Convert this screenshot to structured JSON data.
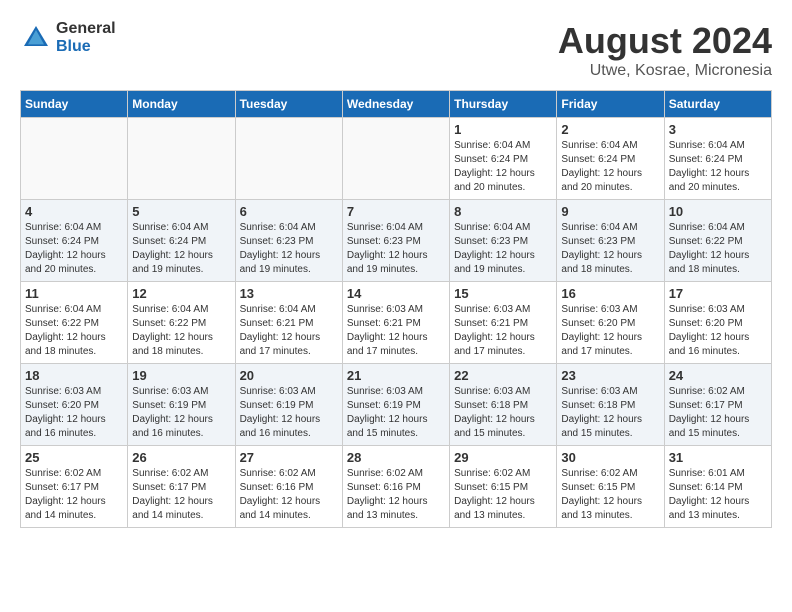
{
  "header": {
    "logo_general": "General",
    "logo_blue": "Blue",
    "month_year": "August 2024",
    "location": "Utwe, Kosrae, Micronesia"
  },
  "days_of_week": [
    "Sunday",
    "Monday",
    "Tuesday",
    "Wednesday",
    "Thursday",
    "Friday",
    "Saturday"
  ],
  "weeks": [
    [
      {
        "day": "",
        "info": ""
      },
      {
        "day": "",
        "info": ""
      },
      {
        "day": "",
        "info": ""
      },
      {
        "day": "",
        "info": ""
      },
      {
        "day": "1",
        "info": "Sunrise: 6:04 AM\nSunset: 6:24 PM\nDaylight: 12 hours\nand 20 minutes."
      },
      {
        "day": "2",
        "info": "Sunrise: 6:04 AM\nSunset: 6:24 PM\nDaylight: 12 hours\nand 20 minutes."
      },
      {
        "day": "3",
        "info": "Sunrise: 6:04 AM\nSunset: 6:24 PM\nDaylight: 12 hours\nand 20 minutes."
      }
    ],
    [
      {
        "day": "4",
        "info": "Sunrise: 6:04 AM\nSunset: 6:24 PM\nDaylight: 12 hours\nand 20 minutes."
      },
      {
        "day": "5",
        "info": "Sunrise: 6:04 AM\nSunset: 6:24 PM\nDaylight: 12 hours\nand 19 minutes."
      },
      {
        "day": "6",
        "info": "Sunrise: 6:04 AM\nSunset: 6:23 PM\nDaylight: 12 hours\nand 19 minutes."
      },
      {
        "day": "7",
        "info": "Sunrise: 6:04 AM\nSunset: 6:23 PM\nDaylight: 12 hours\nand 19 minutes."
      },
      {
        "day": "8",
        "info": "Sunrise: 6:04 AM\nSunset: 6:23 PM\nDaylight: 12 hours\nand 19 minutes."
      },
      {
        "day": "9",
        "info": "Sunrise: 6:04 AM\nSunset: 6:23 PM\nDaylight: 12 hours\nand 18 minutes."
      },
      {
        "day": "10",
        "info": "Sunrise: 6:04 AM\nSunset: 6:22 PM\nDaylight: 12 hours\nand 18 minutes."
      }
    ],
    [
      {
        "day": "11",
        "info": "Sunrise: 6:04 AM\nSunset: 6:22 PM\nDaylight: 12 hours\nand 18 minutes."
      },
      {
        "day": "12",
        "info": "Sunrise: 6:04 AM\nSunset: 6:22 PM\nDaylight: 12 hours\nand 18 minutes."
      },
      {
        "day": "13",
        "info": "Sunrise: 6:04 AM\nSunset: 6:21 PM\nDaylight: 12 hours\nand 17 minutes."
      },
      {
        "day": "14",
        "info": "Sunrise: 6:03 AM\nSunset: 6:21 PM\nDaylight: 12 hours\nand 17 minutes."
      },
      {
        "day": "15",
        "info": "Sunrise: 6:03 AM\nSunset: 6:21 PM\nDaylight: 12 hours\nand 17 minutes."
      },
      {
        "day": "16",
        "info": "Sunrise: 6:03 AM\nSunset: 6:20 PM\nDaylight: 12 hours\nand 17 minutes."
      },
      {
        "day": "17",
        "info": "Sunrise: 6:03 AM\nSunset: 6:20 PM\nDaylight: 12 hours\nand 16 minutes."
      }
    ],
    [
      {
        "day": "18",
        "info": "Sunrise: 6:03 AM\nSunset: 6:20 PM\nDaylight: 12 hours\nand 16 minutes."
      },
      {
        "day": "19",
        "info": "Sunrise: 6:03 AM\nSunset: 6:19 PM\nDaylight: 12 hours\nand 16 minutes."
      },
      {
        "day": "20",
        "info": "Sunrise: 6:03 AM\nSunset: 6:19 PM\nDaylight: 12 hours\nand 16 minutes."
      },
      {
        "day": "21",
        "info": "Sunrise: 6:03 AM\nSunset: 6:19 PM\nDaylight: 12 hours\nand 15 minutes."
      },
      {
        "day": "22",
        "info": "Sunrise: 6:03 AM\nSunset: 6:18 PM\nDaylight: 12 hours\nand 15 minutes."
      },
      {
        "day": "23",
        "info": "Sunrise: 6:03 AM\nSunset: 6:18 PM\nDaylight: 12 hours\nand 15 minutes."
      },
      {
        "day": "24",
        "info": "Sunrise: 6:02 AM\nSunset: 6:17 PM\nDaylight: 12 hours\nand 15 minutes."
      }
    ],
    [
      {
        "day": "25",
        "info": "Sunrise: 6:02 AM\nSunset: 6:17 PM\nDaylight: 12 hours\nand 14 minutes."
      },
      {
        "day": "26",
        "info": "Sunrise: 6:02 AM\nSunset: 6:17 PM\nDaylight: 12 hours\nand 14 minutes."
      },
      {
        "day": "27",
        "info": "Sunrise: 6:02 AM\nSunset: 6:16 PM\nDaylight: 12 hours\nand 14 minutes."
      },
      {
        "day": "28",
        "info": "Sunrise: 6:02 AM\nSunset: 6:16 PM\nDaylight: 12 hours\nand 13 minutes."
      },
      {
        "day": "29",
        "info": "Sunrise: 6:02 AM\nSunset: 6:15 PM\nDaylight: 12 hours\nand 13 minutes."
      },
      {
        "day": "30",
        "info": "Sunrise: 6:02 AM\nSunset: 6:15 PM\nDaylight: 12 hours\nand 13 minutes."
      },
      {
        "day": "31",
        "info": "Sunrise: 6:01 AM\nSunset: 6:14 PM\nDaylight: 12 hours\nand 13 minutes."
      }
    ]
  ]
}
